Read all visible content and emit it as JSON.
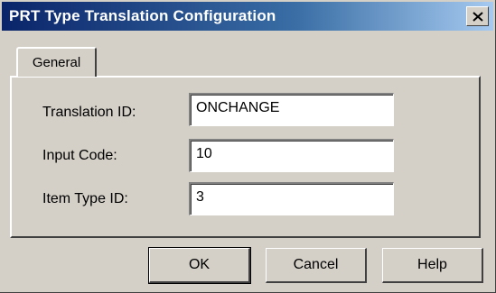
{
  "window": {
    "title": "PRT Type Translation Configuration",
    "close_icon": "close-icon"
  },
  "tabs": [
    {
      "label": "General",
      "selected": true
    }
  ],
  "fields": {
    "translation_id": {
      "label": "Translation ID:",
      "value": "ONCHANGE"
    },
    "input_code": {
      "label": "Input Code:",
      "value": "10"
    },
    "item_type_id": {
      "label": "Item Type ID:",
      "value": "3"
    }
  },
  "buttons": {
    "ok": "OK",
    "cancel": "Cancel",
    "help": "Help"
  },
  "colors": {
    "dialog_face": "#d4d0c8",
    "titlebar_start": "#0a246a",
    "titlebar_end": "#a6caf0"
  }
}
